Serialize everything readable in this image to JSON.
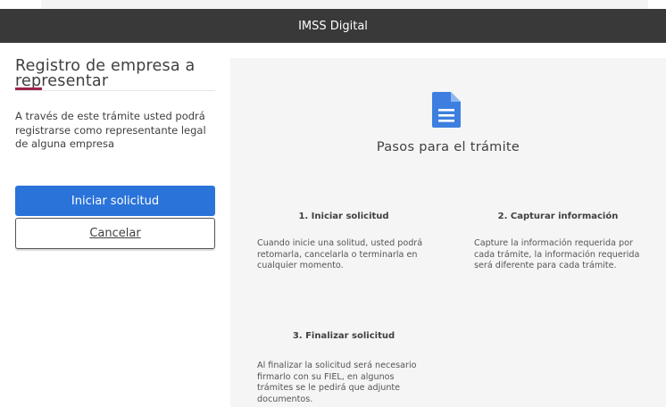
{
  "header": {
    "title": "IMSS Digital"
  },
  "sidebar": {
    "title": "Registro de empresa a representar",
    "description": "A través de este trámite usted podrá registrarse como representante legal de alguna empresa",
    "primary_button": "Iniciar solicitud",
    "secondary_button": "Cancelar"
  },
  "main": {
    "icon": "document-icon",
    "heading": "Pasos para el trámite",
    "steps": [
      {
        "title": "1. Iniciar solicitud",
        "text": "Cuando inicie una solitud, usted podrá retomarla, cancelarla o terminarla en cualquier momento."
      },
      {
        "title": "2. Capturar información",
        "text": "Capture la información requerida por cada trámite, la información requerida será diferente para cada trámite."
      },
      {
        "title": "3. Finalizar solicitud",
        "text": "Al finalizar la solicitud será necesario firmarlo con su FIEL, en algunos trámites se le pedirá que adjunte documentos."
      }
    ]
  },
  "colors": {
    "header_bg": "#393939",
    "primary_button": "#2a73d9",
    "accent_red": "#9d2449",
    "panel_bg": "#f5f5f5",
    "icon_blue": "#3c7fe0"
  }
}
